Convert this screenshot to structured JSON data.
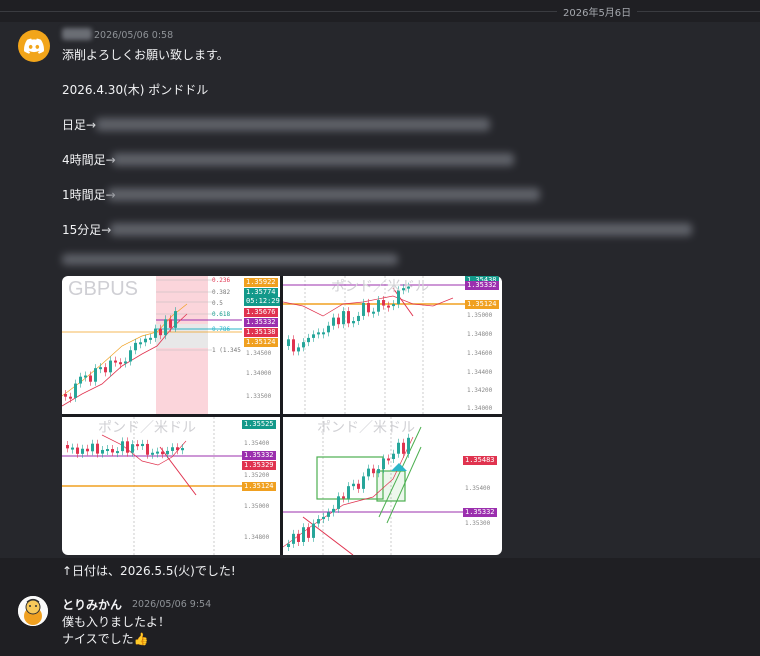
{
  "divider": {
    "date": "2026年5月6日"
  },
  "message1": {
    "timestamp": "2026/05/06 0:58",
    "lines": [
      "添削よろしくお願い致します。",
      "2026.4.30(木) ポンドドル",
      "日足→",
      "4時間足→",
      "1時間足→",
      "15分足→",
      "↑日付は、2026.5.5(火)でした!"
    ]
  },
  "chart1": {
    "symbol": "GBPUS",
    "fib": [
      "0.236",
      "0.382",
      "0.5",
      "0.618",
      "0.786",
      "1 (1.345"
    ],
    "price_tags": [
      "1.35922",
      "1.35774",
      "05:12:29",
      "1.35676",
      "1.35332",
      "1.35138",
      "1.35124"
    ],
    "axis": [
      "1.34500",
      "1.34000",
      "1.33500"
    ]
  },
  "chart2": {
    "title": "ポンド／米ドル",
    "price_tags": [
      "1.35438",
      "1.35332",
      "1.35124"
    ],
    "axis": [
      "1.35000",
      "1.34800",
      "1.34600",
      "1.34400",
      "1.34200",
      "1.34000"
    ]
  },
  "chart3": {
    "title": "ポンド／米ドル",
    "price_tags": [
      "1.35525",
      "1.35332",
      "1.35329",
      "1.35124"
    ],
    "axis": [
      "1.35400",
      "1.35200",
      "1.35000",
      "1.34800"
    ]
  },
  "chart4": {
    "title": "ポンド／米ドル",
    "price_tags": [
      "1.35483",
      "1.35332"
    ],
    "axis": [
      "1.35400",
      "1.35300"
    ]
  },
  "message2": {
    "username": "とりみかん",
    "timestamp": "2026/05/06 9:54",
    "lines": [
      "僕も入りましたよ！",
      "ナイスでした👍"
    ]
  },
  "colors": {
    "orange": "#f0a020",
    "purple": "#9b2fae",
    "red": "#e0334f",
    "green": "#13998a",
    "teal": "#26a69a",
    "blue": "#2962ff"
  }
}
